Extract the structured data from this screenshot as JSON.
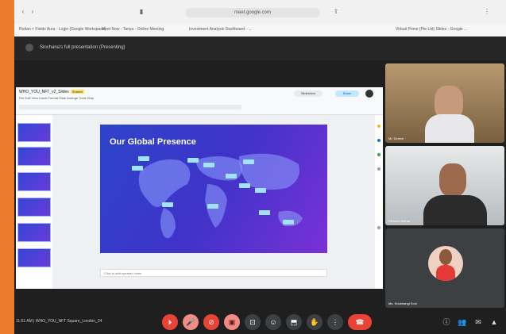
{
  "browser": {
    "address": "meet.google.com",
    "bookmarks": [
      "Rodan + Fields Aura - Login (Google Workspace)",
      "Meet Now - Tanya - Online Meeting",
      "Investment Analysis Dashboard - ...",
      "Virtual Prime (Pte Ltd) Slides - Google ..."
    ]
  },
  "meeting": {
    "title": "Sinchana's full presentation (Presenting)",
    "code": "11:51 AM  |  WHO_YOU_NFT Square_London_24",
    "end_label": "End call"
  },
  "shared_doc": {
    "title": "WHO_YOU_NFT_v2_Slides",
    "badge": "Shared",
    "menus": "File  Edit  View  Insert  Format  Slide  Arrange  Tools  Help",
    "slideshow_button": "Slideshow",
    "share_button": "Share",
    "notes_placeholder": "Click to add speaker notes"
  },
  "slide": {
    "title": "Our Global Presence"
  },
  "participants": [
    {
      "name": "Mr. Dinesh"
    },
    {
      "name": "Rishabh Mehta"
    },
    {
      "name": "Ms. Shubhangi Soni"
    }
  ],
  "colors": {
    "accent_orange": "#ee7a2b",
    "end_call_red": "#ea4335",
    "slide_blue": "#2d44c9"
  }
}
